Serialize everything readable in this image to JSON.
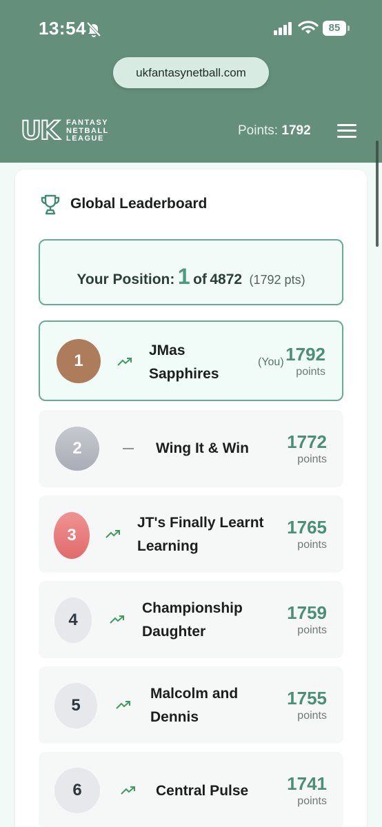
{
  "status_bar": {
    "time": "13:54",
    "battery": "85"
  },
  "browser": {
    "url": "ukfantasynetball.com"
  },
  "header": {
    "logo": {
      "uk": "UK",
      "line1": "FANTASY",
      "line2": "NETBALL",
      "line3": "LEAGUE"
    },
    "points_label": "Points:",
    "points_value": "1792"
  },
  "leaderboard": {
    "title": "Global Leaderboard",
    "position": {
      "label": "Your Position:",
      "rank": "1",
      "of": "of",
      "total": "4872",
      "points": "(1792 pts)"
    },
    "points_label": "points",
    "you_tag": "(You)",
    "rows": [
      {
        "rank": "1",
        "team_line1": "JMas",
        "team_line2": "Sapphires",
        "points": "1792",
        "trend": "up",
        "you": true
      },
      {
        "rank": "2",
        "team_line1": "Wing It & Win",
        "team_line2": "",
        "points": "1772",
        "trend": "same"
      },
      {
        "rank": "3",
        "team_line1": "JT's Finally Learnt",
        "team_line2": "Learning",
        "points": "1765",
        "trend": "up"
      },
      {
        "rank": "4",
        "team_line1": "Championship",
        "team_line2": "Daughter",
        "points": "1759",
        "trend": "up"
      },
      {
        "rank": "5",
        "team_line1": "Malcolm and",
        "team_line2": "Dennis",
        "points": "1755",
        "trend": "up"
      },
      {
        "rank": "6",
        "team_line1": "Central Pulse",
        "team_line2": "",
        "points": "1741",
        "trend": "up"
      }
    ]
  },
  "colors": {
    "header_green": "#64907b",
    "accent": "#4a8f78",
    "border": "#62ab95",
    "trend_up": "#3e9a5f"
  }
}
